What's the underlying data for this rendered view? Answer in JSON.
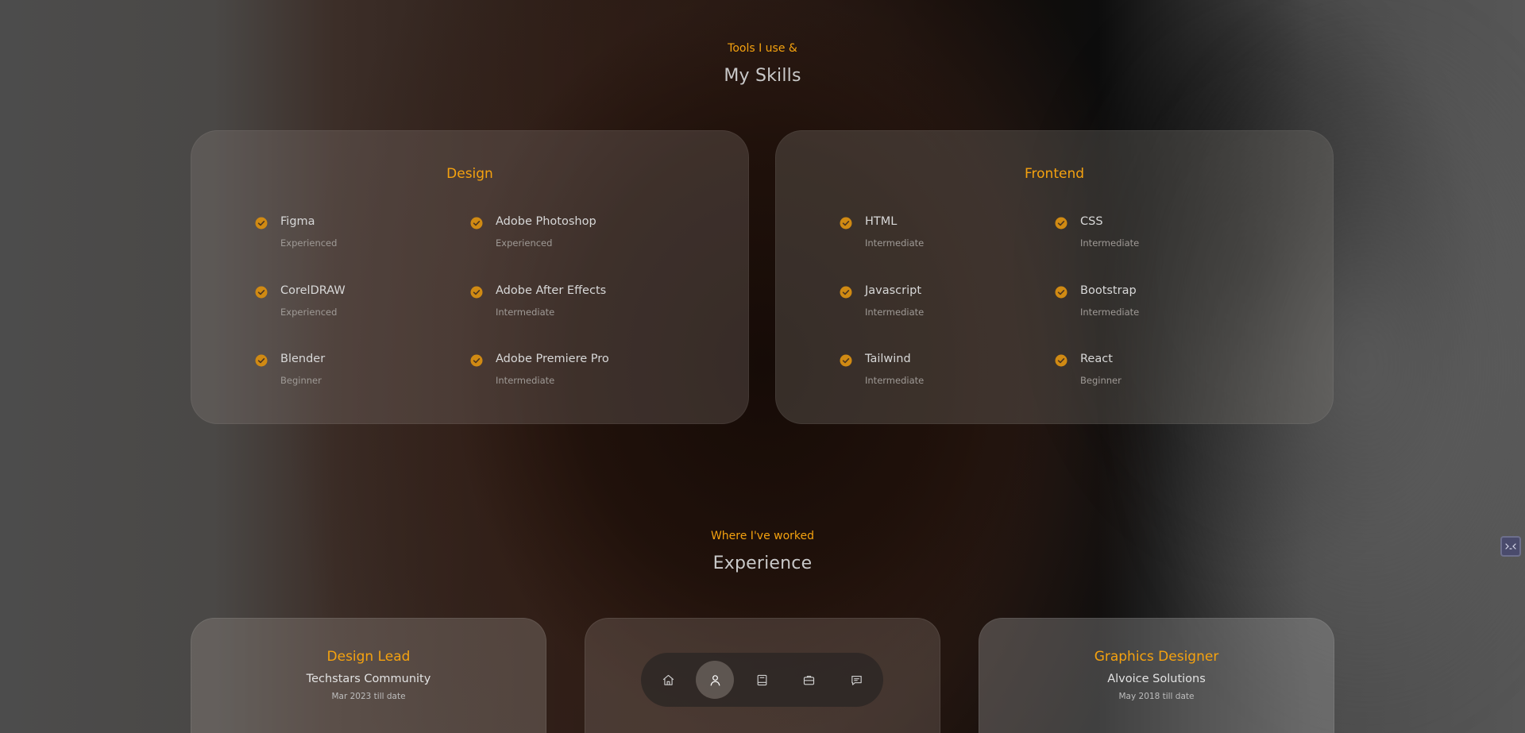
{
  "skills_section": {
    "eyebrow": "Tools I use &",
    "title": "My Skills",
    "groups": [
      {
        "title": "Design",
        "items": [
          {
            "name": "Figma",
            "level": "Experienced"
          },
          {
            "name": "Adobe Photoshop",
            "level": "Experienced"
          },
          {
            "name": "CorelDRAW",
            "level": "Experienced"
          },
          {
            "name": "Adobe After Effects",
            "level": "Intermediate"
          },
          {
            "name": "Blender",
            "level": "Beginner"
          },
          {
            "name": "Adobe Premiere Pro",
            "level": "Intermediate"
          }
        ]
      },
      {
        "title": "Frontend",
        "items": [
          {
            "name": "HTML",
            "level": "Intermediate"
          },
          {
            "name": "CSS",
            "level": "Intermediate"
          },
          {
            "name": "Javascript",
            "level": "Intermediate"
          },
          {
            "name": "Bootstrap",
            "level": "Intermediate"
          },
          {
            "name": "Tailwind",
            "level": "Intermediate"
          },
          {
            "name": "React",
            "level": "Beginner"
          }
        ]
      }
    ]
  },
  "experience_section": {
    "eyebrow": "Where I've worked",
    "title": "Experience",
    "jobs": [
      {
        "title": "Design Lead",
        "company": "Techstars Community",
        "date": "Mar 2023 till date"
      },
      {
        "title": "",
        "company": "",
        "date": ""
      },
      {
        "title": "Graphics Designer",
        "company": "Alvoice Solutions",
        "date": "May 2018 till date"
      }
    ]
  },
  "dock": {
    "items": [
      {
        "icon": "home-icon",
        "active": false
      },
      {
        "icon": "user-icon",
        "active": true
      },
      {
        "icon": "book-icon",
        "active": false
      },
      {
        "icon": "briefcase-icon",
        "active": false
      },
      {
        "icon": "message-icon",
        "active": false
      }
    ]
  },
  "colors": {
    "accent": "#f5a20f",
    "heading": "#c9c9c9"
  }
}
